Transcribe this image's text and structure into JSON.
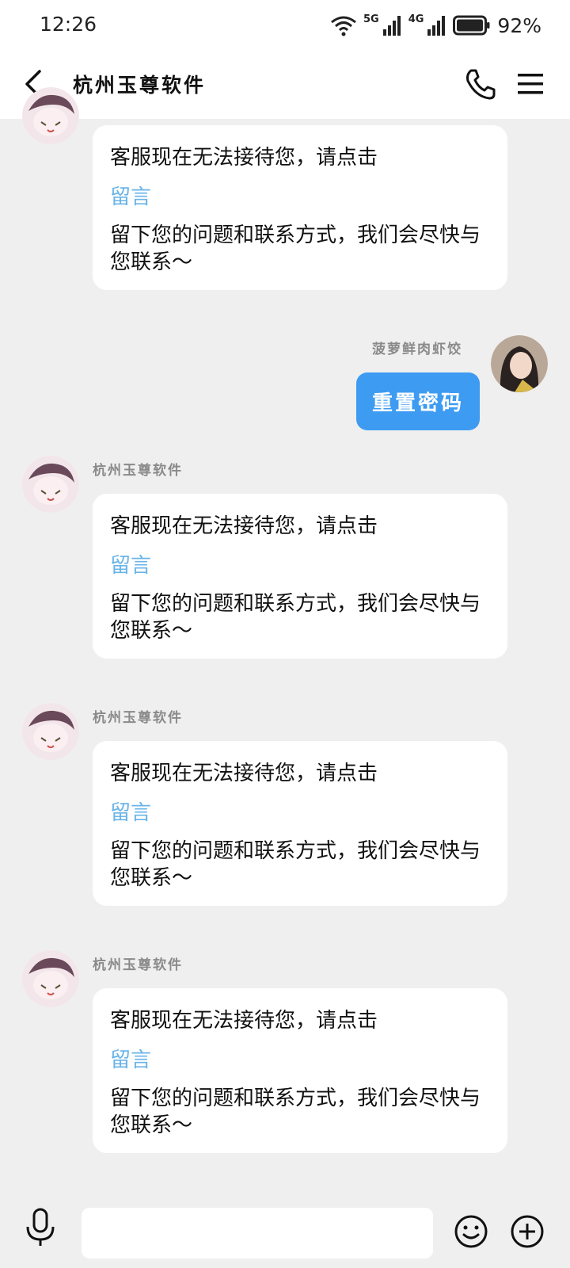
{
  "status_bar": {
    "time": "12:26",
    "net1": "5G",
    "net2": "4G",
    "battery": "92%"
  },
  "header": {
    "title": "杭州玉尊软件"
  },
  "colors": {
    "accent": "#3d9bf2",
    "link": "#6ab4e8",
    "background": "#efefef"
  },
  "messages": [
    {
      "line1": "客服现在无法接待您，请点击",
      "link": "留言",
      "line3": "留下您的问题和联系方式，我们会尽快与您联系～"
    },
    {
      "sender": "杭州玉尊软件",
      "line1": "客服现在无法接待您，请点击",
      "link": "留言",
      "line3": "留下您的问题和联系方式，我们会尽快与您联系～"
    },
    {
      "sender": "杭州玉尊软件",
      "line1": "客服现在无法接待您，请点击",
      "link": "留言",
      "line3": "留下您的问题和联系方式，我们会尽快与您联系～"
    },
    {
      "sender": "杭州玉尊软件",
      "line1": "客服现在无法接待您，请点击",
      "link": "留言",
      "line3": "留下您的问题和联系方式，我们会尽快与您联系～"
    }
  ],
  "my_message": {
    "sender": "菠萝鲜肉虾饺",
    "text": "重置密码"
  },
  "input": {
    "placeholder": ""
  }
}
